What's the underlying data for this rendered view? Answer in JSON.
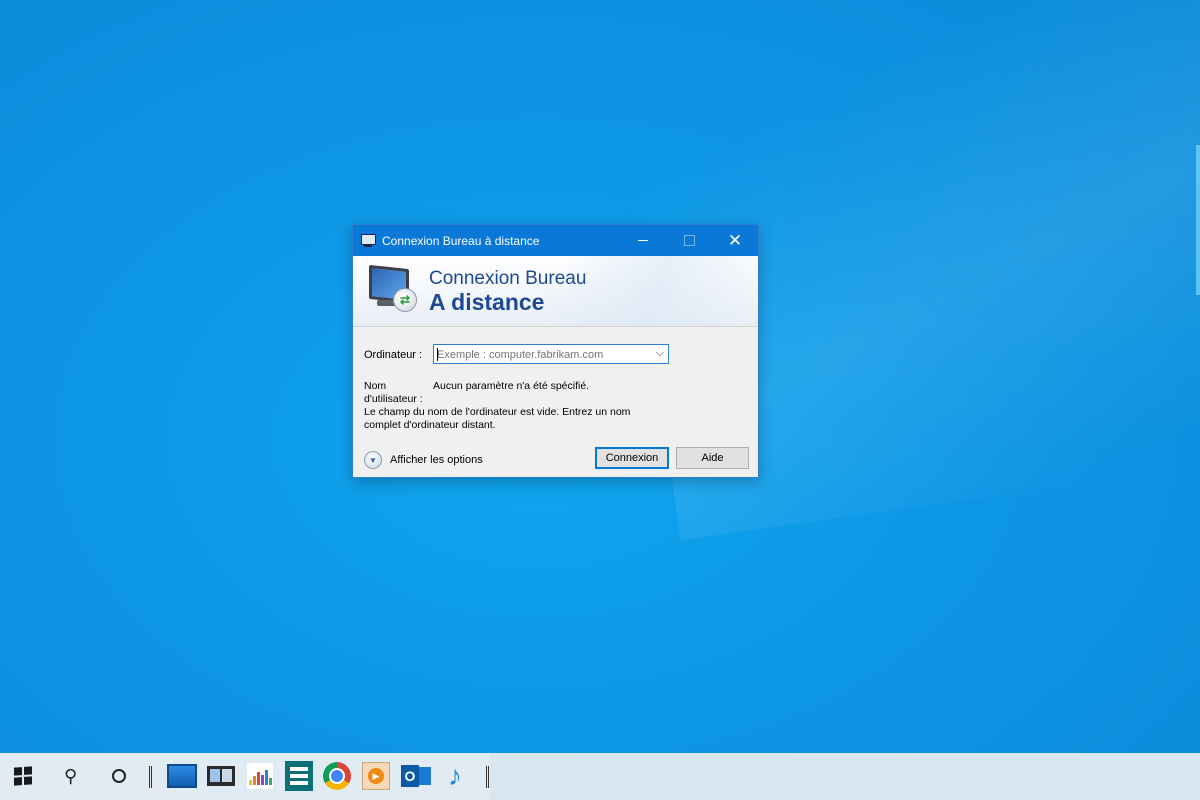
{
  "dialog": {
    "title": "Connexion Bureau à distance",
    "banner_line1": "Connexion Bureau",
    "banner_line2": "A distance",
    "computer_label": "Ordinateur :",
    "computer_value": "",
    "computer_placeholder": "Exemple : computer.fabrikam.com",
    "username_label": "Nom d'utilisateur :",
    "username_value": "Aucun paramètre n'a été spécifié.",
    "error_message": "Le champ du nom de l'ordinateur est vide. Entrez un nom complet d'ordinateur distant.",
    "show_options_label": "Afficher les options",
    "connect_button": "Connexion",
    "help_button": "Aide",
    "close_glyph": "✕",
    "dropdown_glyph": "⌵"
  },
  "taskbar": {
    "icons": [
      "start-windows-icon",
      "search-icon",
      "cortana-icon",
      "remote-desktop-app-icon",
      "dual-monitor-app-icon",
      "equalizer-app-icon",
      "library-app-icon",
      "chrome-icon",
      "media-player-icon",
      "outlook-icon",
      "music-note-icon"
    ]
  },
  "colors": {
    "desktop": "#0d97e6",
    "titlebar": "#0a78d7",
    "banner_text": "#1d4a92",
    "accent_border": "#0078d7",
    "taskbar": "#d9e6f0"
  }
}
